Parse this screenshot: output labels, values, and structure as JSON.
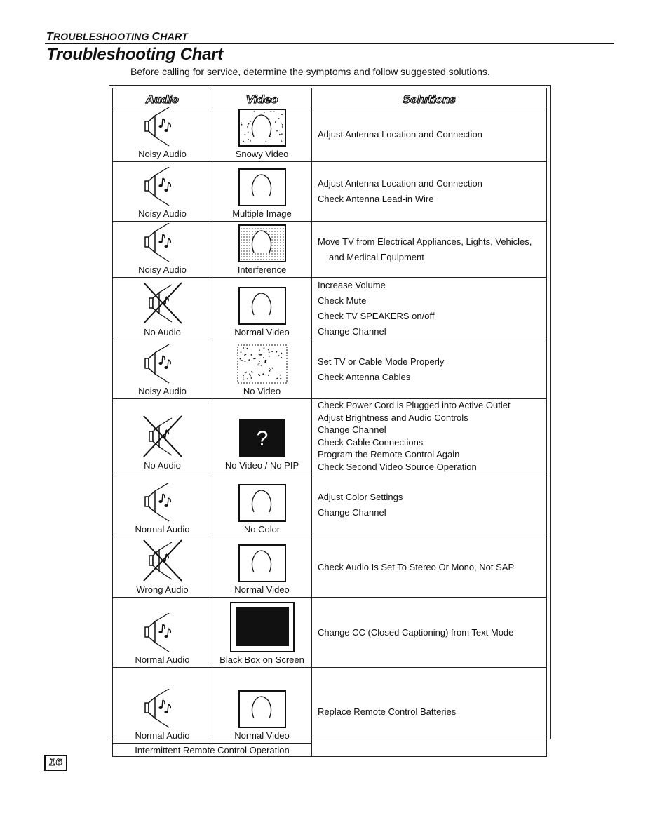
{
  "header": {
    "section_label_first_letter": "T",
    "section_label_rest": "ROUBLESHOOTING ",
    "section_label_first_letter2": "C",
    "section_label_rest2": "HART",
    "title": "Troubleshooting Chart",
    "intro": "Before calling for service, determine the symptoms and follow suggested solutions."
  },
  "table": {
    "columns": [
      "Audio",
      "Video",
      "Solutions"
    ],
    "rows": [
      {
        "audio": "Noisy Audio",
        "audio_icon": "speaker-notes-icon",
        "video": "Snowy Video",
        "video_icon": "snowy-tv-icon",
        "solutions": [
          "Adjust Antenna Location and Connection"
        ]
      },
      {
        "audio": "Noisy Audio",
        "audio_icon": "speaker-notes-icon",
        "video": "Multiple Image",
        "video_icon": "multiple-image-tv-icon",
        "solutions": [
          "Adjust Antenna Location and Connection",
          "Check Antenna Lead-in Wire"
        ]
      },
      {
        "audio": "Noisy Audio",
        "audio_icon": "speaker-notes-icon",
        "video": "Interference",
        "video_icon": "interference-tv-icon",
        "solutions": [
          "Move TV from Electrical Appliances, Lights, Vehicles,",
          "and Medical Equipment"
        ]
      },
      {
        "audio": "No Audio",
        "audio_icon": "speaker-crossed-icon",
        "video": "Normal Video",
        "video_icon": "normal-tv-icon",
        "solutions": [
          "Increase Volume",
          "Check Mute",
          "Check TV SPEAKERS on/off",
          "Change Channel"
        ]
      },
      {
        "audio": "Noisy Audio",
        "audio_icon": "speaker-notes-icon",
        "video": "No Video",
        "video_icon": "static-tv-icon",
        "solutions": [
          "Set TV or Cable Mode Properly",
          "Check Antenna Cables"
        ]
      },
      {
        "audio": "No Audio",
        "audio_icon": "speaker-crossed-icon",
        "video": "No Video / No PIP",
        "video_icon": "question-mark-screen-icon",
        "video_glyph": "?",
        "solutions": [
          "Check Power Cord is Plugged into Active Outlet",
          "Adjust Brightness and Audio Controls",
          "Change Channel",
          "Check Cable Connections",
          "Program the Remote Control Again",
          "Check Second Video Source Operation"
        ]
      },
      {
        "audio": "Normal Audio",
        "audio_icon": "speaker-notes-icon",
        "video": "No Color",
        "video_icon": "normal-tv-icon",
        "solutions": [
          "Adjust Color Settings",
          "Change Channel"
        ]
      },
      {
        "audio": "Wrong Audio",
        "audio_icon": "speaker-crossed-icon",
        "video": "Normal Video",
        "video_icon": "normal-tv-icon",
        "solutions": [
          "Check Audio Is Set To Stereo Or Mono, Not SAP"
        ]
      },
      {
        "audio": "Normal Audio",
        "audio_icon": "speaker-notes-icon",
        "video": "Black Box on Screen",
        "video_icon": "black-box-screen-icon",
        "solutions": [
          "Change CC (Closed Captioning) from Text Mode"
        ]
      },
      {
        "audio": "Normal Audio",
        "audio_icon": "speaker-notes-icon",
        "video": "Normal Video",
        "video_icon": "normal-tv-icon",
        "symptom_footer": "Intermittent Remote Control Operation",
        "solutions": [
          "Replace Remote Control Batteries"
        ]
      }
    ]
  },
  "footer": {
    "page_number": "16"
  }
}
